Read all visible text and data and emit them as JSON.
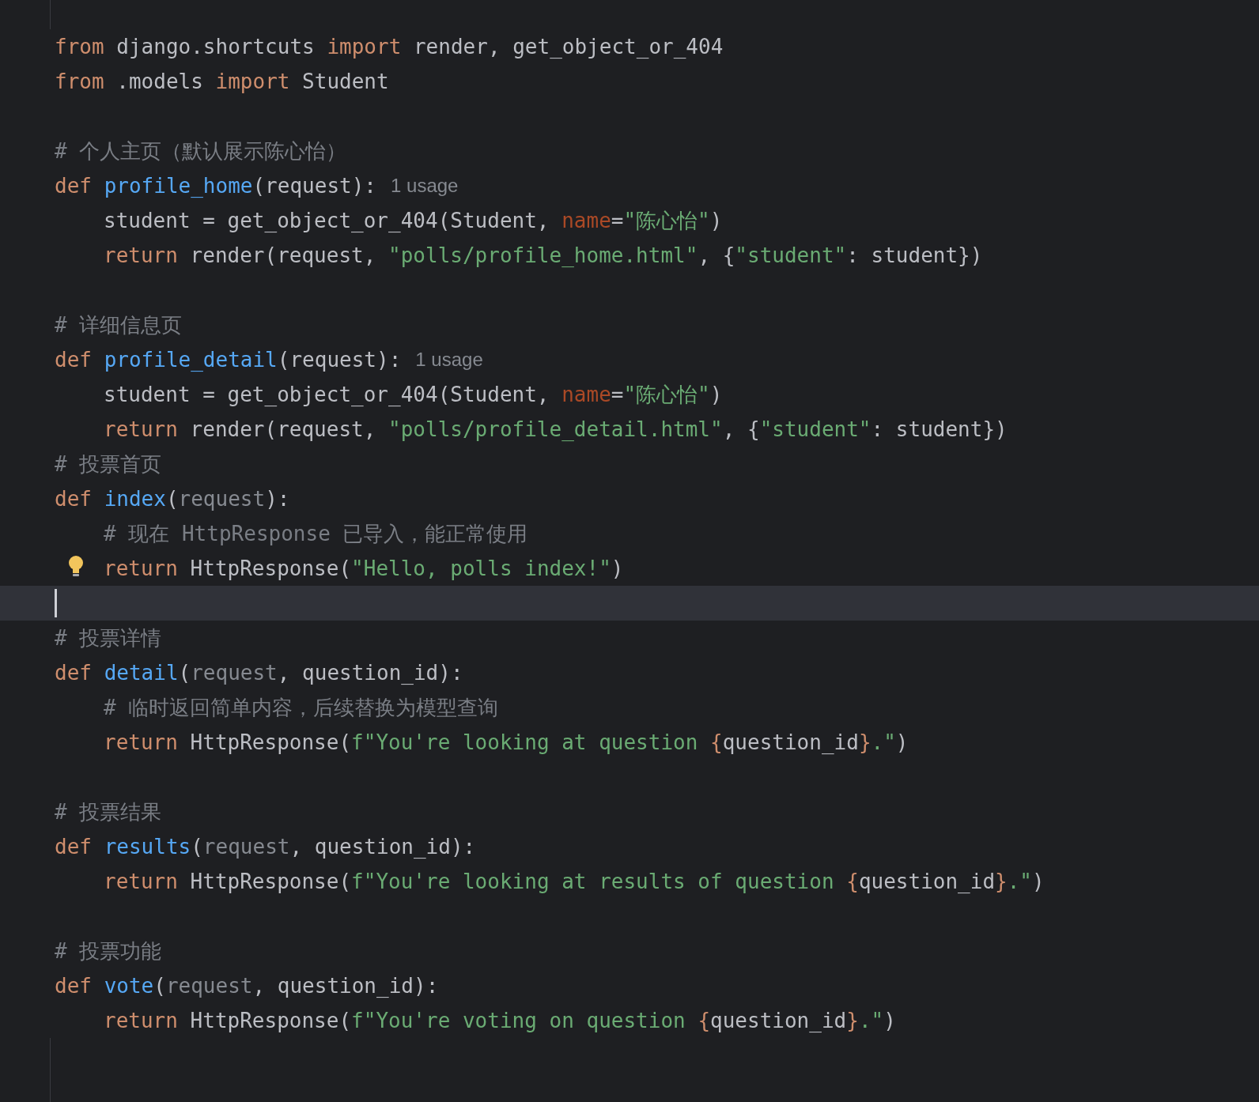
{
  "lines": [
    {
      "current": false,
      "bulb": false,
      "tokens": [
        {
          "kind": "keyword",
          "text": "from"
        },
        {
          "kind": "plain",
          "text": " django.shortcuts "
        },
        {
          "kind": "keyword",
          "text": "import"
        },
        {
          "kind": "plain",
          "text": " render, get_object_or_404"
        }
      ]
    },
    {
      "current": false,
      "bulb": false,
      "tokens": [
        {
          "kind": "keyword",
          "text": "from"
        },
        {
          "kind": "plain",
          "text": " .models "
        },
        {
          "kind": "keyword",
          "text": "import"
        },
        {
          "kind": "plain",
          "text": " Student"
        }
      ]
    },
    {
      "current": false,
      "bulb": false
    },
    {
      "current": false,
      "bulb": false,
      "tokens": [
        {
          "kind": "comment",
          "text": "# 个人主页（默认展示陈心怡）"
        }
      ]
    },
    {
      "current": false,
      "bulb": false,
      "hint": "1 usage",
      "tokens": [
        {
          "kind": "keyword",
          "text": "def "
        },
        {
          "kind": "function",
          "text": "profile_home"
        },
        {
          "kind": "plain",
          "text": "(request):"
        }
      ]
    },
    {
      "current": false,
      "bulb": false,
      "indented": true,
      "tokens": [
        {
          "kind": "plain",
          "text": "student = get_object_or_404(Student, "
        },
        {
          "kind": "named_arg",
          "text": "name"
        },
        {
          "kind": "plain",
          "text": "="
        },
        {
          "kind": "string",
          "text": "\"陈心怡\""
        },
        {
          "kind": "plain",
          "text": ")"
        }
      ]
    },
    {
      "current": false,
      "bulb": false,
      "indented": true,
      "tokens": [
        {
          "kind": "keyword",
          "text": "return"
        },
        {
          "kind": "plain",
          "text": " render(request, "
        },
        {
          "kind": "string",
          "text": "\"polls/profile_home.html\""
        },
        {
          "kind": "plain",
          "text": ", {"
        },
        {
          "kind": "string",
          "text": "\"student\""
        },
        {
          "kind": "plain",
          "text": ": student})"
        }
      ]
    },
    {
      "current": false,
      "bulb": false
    },
    {
      "current": false,
      "bulb": false,
      "tokens": [
        {
          "kind": "comment",
          "text": "# 详细信息页"
        }
      ]
    },
    {
      "current": false,
      "bulb": false,
      "hint": "1 usage",
      "tokens": [
        {
          "kind": "keyword",
          "text": "def "
        },
        {
          "kind": "function",
          "text": "profile_detail"
        },
        {
          "kind": "plain",
          "text": "(request):"
        }
      ]
    },
    {
      "current": false,
      "bulb": false,
      "indented": true,
      "tokens": [
        {
          "kind": "plain",
          "text": "student = get_object_or_404(Student, "
        },
        {
          "kind": "named_arg",
          "text": "name"
        },
        {
          "kind": "plain",
          "text": "="
        },
        {
          "kind": "string",
          "text": "\"陈心怡\""
        },
        {
          "kind": "plain",
          "text": ")"
        }
      ]
    },
    {
      "current": false,
      "bulb": false,
      "indented": true,
      "tokens": [
        {
          "kind": "keyword",
          "text": "return"
        },
        {
          "kind": "plain",
          "text": " render(request, "
        },
        {
          "kind": "string",
          "text": "\"polls/profile_detail.html\""
        },
        {
          "kind": "plain",
          "text": ", {"
        },
        {
          "kind": "string",
          "text": "\"student\""
        },
        {
          "kind": "plain",
          "text": ": student})"
        }
      ]
    },
    {
      "current": false,
      "bulb": false,
      "tokens": [
        {
          "kind": "comment",
          "text": "# 投票首页"
        }
      ]
    },
    {
      "current": false,
      "bulb": false,
      "tokens": [
        {
          "kind": "keyword",
          "text": "def "
        },
        {
          "kind": "function",
          "text": "index"
        },
        {
          "kind": "plain",
          "text": "("
        },
        {
          "kind": "unused",
          "text": "request"
        },
        {
          "kind": "plain",
          "text": "):"
        }
      ]
    },
    {
      "current": false,
      "bulb": false,
      "indented": true,
      "tokens": [
        {
          "kind": "comment",
          "text": "# 现在 HttpResponse 已导入，能正常使用"
        }
      ]
    },
    {
      "current": false,
      "bulb": true,
      "indented": true,
      "tokens": [
        {
          "kind": "keyword",
          "text": "return"
        },
        {
          "kind": "plain",
          "text": " HttpResponse("
        },
        {
          "kind": "string",
          "text": "\"Hello, polls index!\""
        },
        {
          "kind": "plain",
          "text": ")"
        }
      ]
    },
    {
      "current": true,
      "bulb": false
    },
    {
      "current": false,
      "bulb": false,
      "tokens": [
        {
          "kind": "comment",
          "text": "# 投票详情"
        }
      ]
    },
    {
      "current": false,
      "bulb": false,
      "tokens": [
        {
          "kind": "keyword",
          "text": "def "
        },
        {
          "kind": "function",
          "text": "detail"
        },
        {
          "kind": "plain",
          "text": "("
        },
        {
          "kind": "unused",
          "text": "request"
        },
        {
          "kind": "plain",
          "text": ", question_id):"
        }
      ]
    },
    {
      "current": false,
      "bulb": false,
      "indented": true,
      "tokens": [
        {
          "kind": "comment",
          "text": "# 临时返回简单内容，后续替换为模型查询"
        }
      ]
    },
    {
      "current": false,
      "bulb": false,
      "indented": true,
      "tokens": [
        {
          "kind": "keyword",
          "text": "return"
        },
        {
          "kind": "plain",
          "text": " HttpResponse("
        },
        {
          "kind": "string",
          "text": "f\"You're looking at question "
        },
        {
          "kind": "brace",
          "text": "{"
        },
        {
          "kind": "plain",
          "text": "question_id"
        },
        {
          "kind": "brace",
          "text": "}"
        },
        {
          "kind": "string",
          "text": ".\""
        },
        {
          "kind": "plain",
          "text": ")"
        }
      ]
    },
    {
      "current": false,
      "bulb": false
    },
    {
      "current": false,
      "bulb": false,
      "tokens": [
        {
          "kind": "comment",
          "text": "# 投票结果"
        }
      ]
    },
    {
      "current": false,
      "bulb": false,
      "tokens": [
        {
          "kind": "keyword",
          "text": "def "
        },
        {
          "kind": "function",
          "text": "results"
        },
        {
          "kind": "plain",
          "text": "("
        },
        {
          "kind": "unused",
          "text": "request"
        },
        {
          "kind": "plain",
          "text": ", question_id):"
        }
      ]
    },
    {
      "current": false,
      "bulb": false,
      "indented": true,
      "tokens": [
        {
          "kind": "keyword",
          "text": "return"
        },
        {
          "kind": "plain",
          "text": " HttpResponse("
        },
        {
          "kind": "string",
          "text": "f\"You're looking at results of question "
        },
        {
          "kind": "brace",
          "text": "{"
        },
        {
          "kind": "plain",
          "text": "question_id"
        },
        {
          "kind": "brace",
          "text": "}"
        },
        {
          "kind": "string",
          "text": ".\""
        },
        {
          "kind": "plain",
          "text": ")"
        }
      ]
    },
    {
      "current": false,
      "bulb": false
    },
    {
      "current": false,
      "bulb": false,
      "tokens": [
        {
          "kind": "comment",
          "text": "# 投票功能"
        }
      ]
    },
    {
      "current": false,
      "bulb": false,
      "tokens": [
        {
          "kind": "keyword",
          "text": "def "
        },
        {
          "kind": "function",
          "text": "vote"
        },
        {
          "kind": "plain",
          "text": "("
        },
        {
          "kind": "unused",
          "text": "request"
        },
        {
          "kind": "plain",
          "text": ", question_id):"
        }
      ]
    },
    {
      "current": false,
      "bulb": false,
      "indented": true,
      "tokens": [
        {
          "kind": "keyword",
          "text": "return"
        },
        {
          "kind": "plain",
          "text": " HttpResponse("
        },
        {
          "kind": "string",
          "text": "f\"You're voting on question "
        },
        {
          "kind": "brace",
          "text": "{"
        },
        {
          "kind": "plain",
          "text": "question_id"
        },
        {
          "kind": "brace",
          "text": "}"
        },
        {
          "kind": "string",
          "text": ".\""
        },
        {
          "kind": "plain",
          "text": ")"
        }
      ]
    }
  ]
}
